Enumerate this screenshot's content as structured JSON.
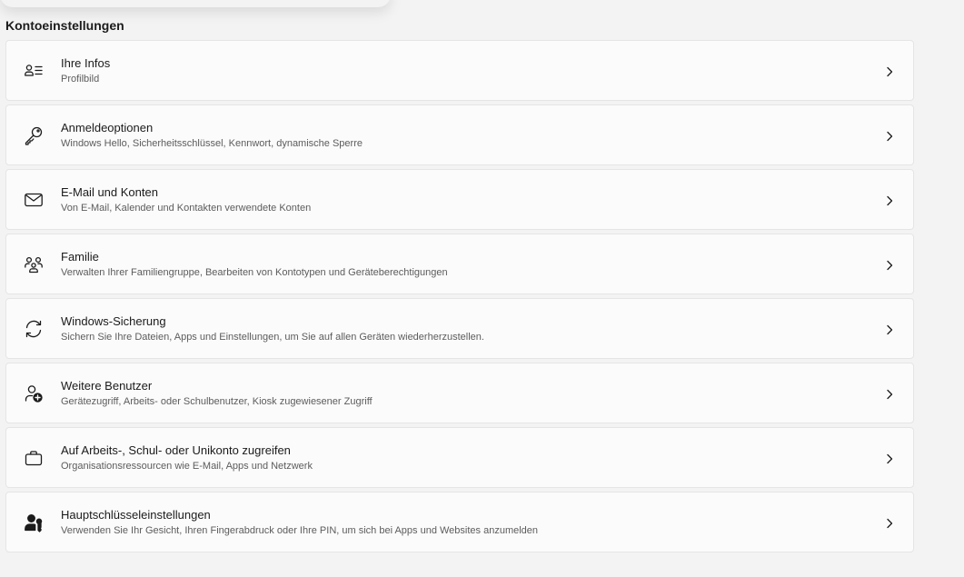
{
  "section_title": "Kontoeinstellungen",
  "items": [
    {
      "title": "Ihre Infos",
      "subtitle": "Profilbild",
      "icon": "contact-info-icon"
    },
    {
      "title": "Anmeldeoptionen",
      "subtitle": "Windows Hello, Sicherheitsschlüssel, Kennwort, dynamische Sperre",
      "icon": "key-icon"
    },
    {
      "title": "E-Mail und Konten",
      "subtitle": "Von E-Mail, Kalender und Kontakten verwendete Konten",
      "icon": "mail-icon"
    },
    {
      "title": "Familie",
      "subtitle": "Verwalten Ihrer Familiengruppe, Bearbeiten von Kontotypen und Geräteberechtigungen",
      "icon": "family-icon"
    },
    {
      "title": "Windows-Sicherung",
      "subtitle": "Sichern Sie Ihre Dateien, Apps und Einstellungen, um Sie auf allen Geräten wiederherzustellen.",
      "icon": "sync-icon"
    },
    {
      "title": "Weitere Benutzer",
      "subtitle": "Gerätezugriff, Arbeits- oder Schulbenutzer, Kiosk zugewiesener Zugriff",
      "icon": "add-user-icon"
    },
    {
      "title": "Auf Arbeits-, Schul- oder Unikonto zugreifen",
      "subtitle": "Organisationsressourcen wie E-Mail, Apps und Netzwerk",
      "icon": "briefcase-icon"
    },
    {
      "title": "Hauptschlüsseleinstellungen",
      "subtitle": "Verwenden Sie Ihr Gesicht, Ihren Fingerabdruck oder Ihre PIN, um sich bei Apps und Websites anzumelden",
      "icon": "passkey-icon"
    }
  ]
}
